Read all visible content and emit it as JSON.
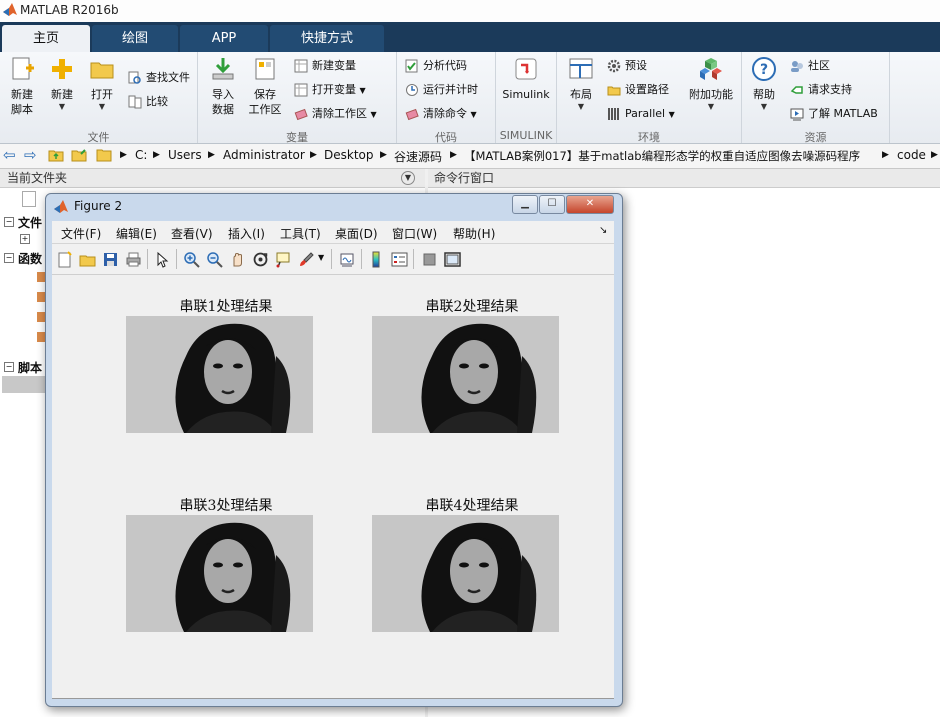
{
  "app": {
    "title": "MATLAB R2016b"
  },
  "tabs": [
    {
      "label": "主页",
      "active": true
    },
    {
      "label": "绘图",
      "active": false
    },
    {
      "label": "APP",
      "active": false
    },
    {
      "label": "快捷方式",
      "active": false
    }
  ],
  "ribbon": {
    "file": {
      "label": "文件",
      "new_script": "新建\n脚本",
      "new": "新建",
      "open": "打开",
      "find_files": "查找文件",
      "compare": "比较"
    },
    "variable": {
      "label": "变量",
      "import": "导入\n数据",
      "save_ws": "保存\n工作区",
      "new_var": "新建变量",
      "open_var": "打开变量",
      "clear_ws": "清除工作区"
    },
    "code": {
      "label": "代码",
      "analyze": "分析代码",
      "run_time": "运行并计时",
      "clear_cmd": "清除命令"
    },
    "simulink": {
      "label": "SIMULINK",
      "btn": "Simulink"
    },
    "env": {
      "label": "环境",
      "layout": "布局",
      "prefs": "预设",
      "set_path": "设置路径",
      "parallel": "Parallel",
      "addons": "附加功能"
    },
    "resources": {
      "label": "资源",
      "help": "帮助",
      "community": "社区",
      "support": "请求支持",
      "learn": "了解 MATLAB"
    }
  },
  "address": {
    "segments": [
      "C:",
      "Users",
      "Administrator",
      "Desktop",
      "谷速源码",
      "【MATLAB案例017】基于matlab编程形态学的权重自适应图像去噪源码程序",
      "code"
    ]
  },
  "panels": {
    "current_folder": "当前文件夹",
    "command_window": "命令行窗口",
    "tree": [
      "文件",
      "函数",
      "脚本"
    ]
  },
  "figure": {
    "title": "Figure 2",
    "menu": [
      "文件(F)",
      "编辑(E)",
      "查看(V)",
      "插入(I)",
      "工具(T)",
      "桌面(D)",
      "窗口(W)",
      "帮助(H)"
    ],
    "subplots": [
      {
        "title": "串联1处理结果"
      },
      {
        "title": "串联2处理结果"
      },
      {
        "title": "串联3处理结果"
      },
      {
        "title": "串联4处理结果"
      }
    ]
  },
  "colors": {
    "tabbar": "#1b3a5a",
    "tab": "#224b73",
    "accent": "#2d6db5"
  }
}
